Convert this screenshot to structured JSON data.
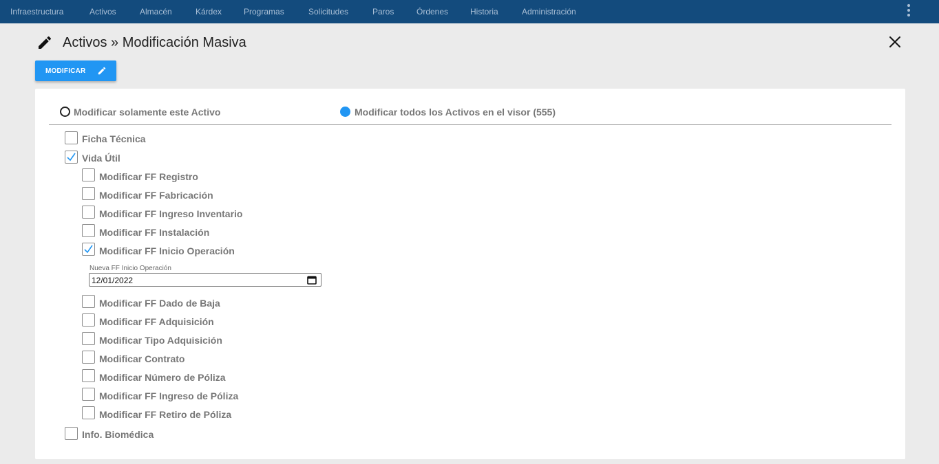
{
  "nav": {
    "items": [
      "Infraestructura",
      "Activos",
      "Almacén",
      "Kárdex",
      "Programas",
      "Solicitudes",
      "Paros",
      "Órdenes",
      "Historia",
      "Administración"
    ],
    "menu_icon": "kebab-menu-icon"
  },
  "header": {
    "title": "Activos » Modificación Masiva",
    "title_icon": "pencil-icon",
    "close_icon": "close-icon"
  },
  "toolbar": {
    "modify_label": "MODIFICAR",
    "modify_icon": "pencil-icon"
  },
  "scope": {
    "option_single": "Modificar solamente este Activo",
    "option_all": "Modificar todos los Activos en el visor (555)",
    "selected": "all"
  },
  "sections": {
    "ficha": {
      "label": "Ficha Técnica",
      "checked": false
    },
    "vida": {
      "label": "Vida Útil",
      "checked": true
    },
    "info": {
      "label": "Info. Biomédica",
      "checked": false
    }
  },
  "vida_items": [
    {
      "label": "Modificar FF Registro",
      "checked": false
    },
    {
      "label": "Modificar FF Fabricación",
      "checked": false
    },
    {
      "label": "Modificar FF Ingreso Inventario",
      "checked": false
    },
    {
      "label": "Modificar FF Instalación",
      "checked": false
    },
    {
      "label": "Modificar FF Inicio Operación",
      "checked": true
    },
    {
      "label": "Modificar FF Dado de Baja",
      "checked": false
    },
    {
      "label": "Modificar FF Adquisición",
      "checked": false
    },
    {
      "label": "Modificar Tipo Adquisición",
      "checked": false
    },
    {
      "label": "Modificar Contrato",
      "checked": false
    },
    {
      "label": "Modificar Número de Póliza",
      "checked": false
    },
    {
      "label": "Modificar FF Ingreso de Póliza",
      "checked": false
    },
    {
      "label": "Modificar FF Retiro de Póliza",
      "checked": false
    }
  ],
  "inicio_operacion": {
    "caption": "Nueva FF Inicio Operación",
    "value": "12/01/2022",
    "calendar_icon": "calendar-icon"
  },
  "colors": {
    "nav_bg": "#134b7d",
    "nav_text": "#a9bfd6",
    "accent": "#2196f3",
    "page_bg": "#ebebeb",
    "panel_bg": "#ffffff"
  }
}
